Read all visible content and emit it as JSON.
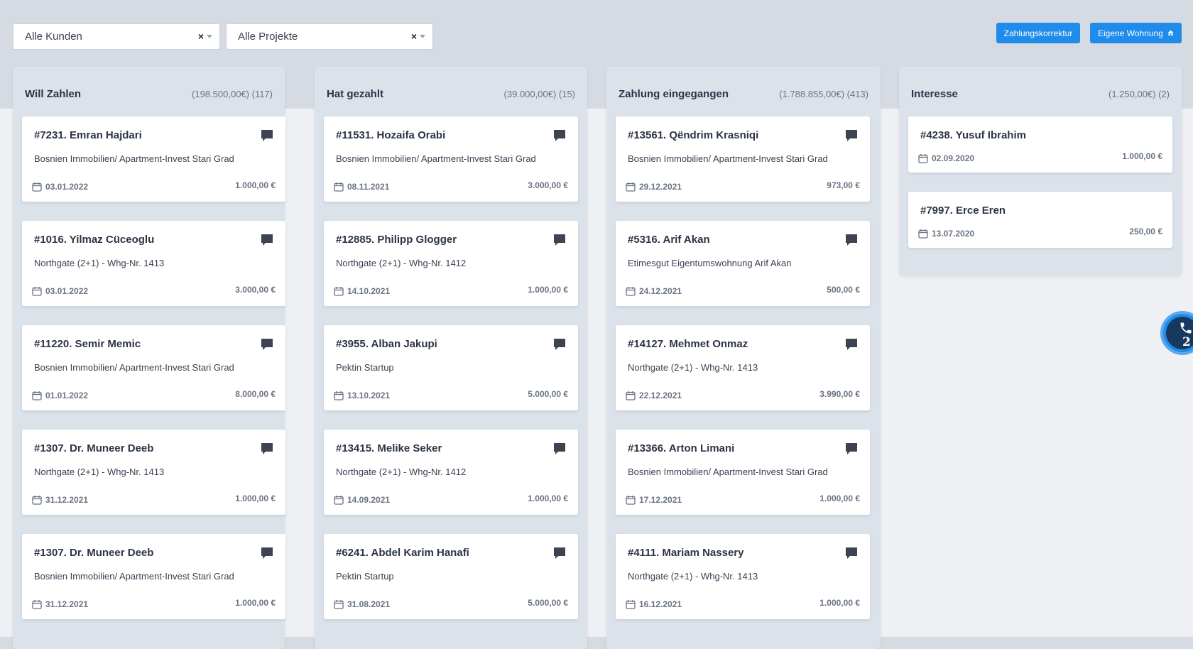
{
  "filters": {
    "customers": "Alle Kunden",
    "projects": "Alle Projekte",
    "clear_glyph": "×"
  },
  "buttons": {
    "payment_correction": "Zahlungskorrektur",
    "own_apartment": "Eigene Wohnung"
  },
  "colors": {
    "accent": "#1f8ceb",
    "column_bg": "#dce2ea",
    "page_bg": "#eef0f4"
  },
  "columns": [
    {
      "title": "Will Zahlen",
      "summary": "(198.500,00€) (117)",
      "cards": [
        {
          "title": "#7231. Emran Hajdari",
          "project": "Bosnien Immobilien/ Apartment-Invest Stari Grad",
          "date": "03.01.2022",
          "amount": "1.000,00 €"
        },
        {
          "title": "#1016. Yilmaz Cüceoglu",
          "project": "Northgate (2+1) - Whg-Nr. 1413",
          "date": "03.01.2022",
          "amount": "3.000,00 €"
        },
        {
          "title": "#11220. Semir Memic",
          "project": "Bosnien Immobilien/ Apartment-Invest Stari Grad",
          "date": "01.01.2022",
          "amount": "8.000,00 €"
        },
        {
          "title": "#1307. Dr. Muneer Deeb",
          "project": "Northgate (2+1) - Whg-Nr. 1413",
          "date": "31.12.2021",
          "amount": "1.000,00 €"
        },
        {
          "title": "#1307. Dr. Muneer Deeb",
          "project": "Bosnien Immobilien/ Apartment-Invest Stari Grad",
          "date": "31.12.2021",
          "amount": "1.000,00 €"
        }
      ]
    },
    {
      "title": "Hat gezahlt",
      "summary": "(39.000,00€) (15)",
      "cards": [
        {
          "title": "#11531. Hozaifa Orabi",
          "project": "Bosnien Immobilien/ Apartment-Invest Stari Grad",
          "date": "08.11.2021",
          "amount": "3.000,00 €"
        },
        {
          "title": "#12885. Philipp Glogger",
          "project": "Northgate (2+1) - Whg-Nr. 1412",
          "date": "14.10.2021",
          "amount": "1.000,00 €"
        },
        {
          "title": "#3955. Alban Jakupi",
          "project": "Pektin Startup",
          "date": "13.10.2021",
          "amount": "5.000,00 €"
        },
        {
          "title": "#13415. Melike Seker",
          "project": "Northgate (2+1) - Whg-Nr. 1412",
          "date": "14.09.2021",
          "amount": "1.000,00 €"
        },
        {
          "title": "#6241. Abdel Karim Hanafi",
          "project": "Pektin Startup",
          "date": "31.08.2021",
          "amount": "5.000,00 €"
        }
      ]
    },
    {
      "title": "Zahlung eingegangen",
      "summary": "(1.788.855,00€) (413)",
      "cards": [
        {
          "title": "#13561. Qëndrim Krasniqi",
          "project": "Bosnien Immobilien/ Apartment-Invest Stari Grad",
          "date": "29.12.2021",
          "amount": "973,00 €"
        },
        {
          "title": "#5316. Arif Akan",
          "project": "Etimesgut Eigentumswohnung Arif Akan",
          "date": "24.12.2021",
          "amount": "500,00 €"
        },
        {
          "title": "#14127. Mehmet Onmaz",
          "project": "Northgate (2+1) - Whg-Nr. 1413",
          "date": "22.12.2021",
          "amount": "3.990,00 €"
        },
        {
          "title": "#13366. Arton Limani",
          "project": "Bosnien Immobilien/ Apartment-Invest Stari Grad",
          "date": "17.12.2021",
          "amount": "1.000,00 €"
        },
        {
          "title": "#4111. Mariam Nassery",
          "project": "Northgate (2+1) - Whg-Nr. 1413",
          "date": "16.12.2021",
          "amount": "1.000,00 €"
        }
      ]
    },
    {
      "title": "Interesse",
      "summary": "(1.250,00€) (2)",
      "cards": [
        {
          "title": "#4238. Yusuf Ibrahim",
          "date": "02.09.2020",
          "amount": "1.000,00 €"
        },
        {
          "title": "#7997. Erce Eren",
          "date": "13.07.2020",
          "amount": "250,00 €"
        }
      ]
    }
  ],
  "call_widget": {
    "icon": "phone-icon",
    "count": "2"
  }
}
